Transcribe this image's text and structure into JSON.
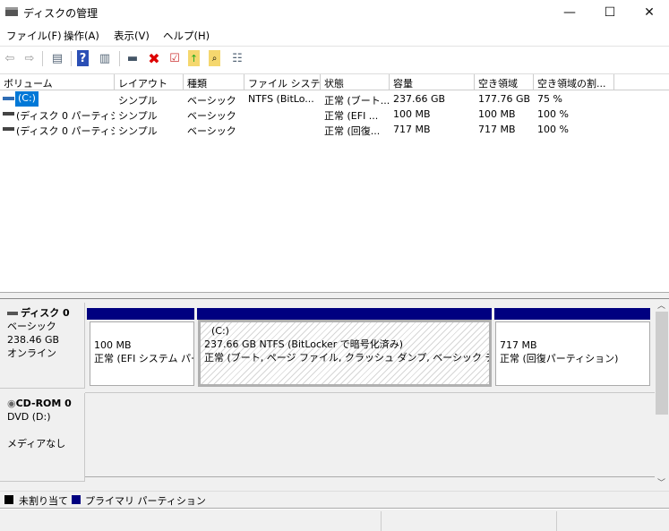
{
  "window": {
    "title": "ディスクの管理",
    "controls": [
      "minimize",
      "maximize",
      "close"
    ]
  },
  "menu": [
    {
      "label": "ファイル(F)"
    },
    {
      "label": "操作(A)"
    },
    {
      "label": "表示(V)"
    },
    {
      "label": "ヘルプ(H)"
    }
  ],
  "toolbar": [
    "back-icon",
    "forward-icon",
    "show-hide-console-tree-icon",
    "help-icon",
    "show-hide-action-pane-icon",
    "connect-disk-icon",
    "delete-icon",
    "properties-icon",
    "import-icon",
    "search-icon",
    "list-view-icon"
  ],
  "table": {
    "columns": [
      "ボリューム",
      "レイアウト",
      "種類",
      "ファイル システム",
      "状態",
      "容量",
      "空き領域",
      "空き領域の割..."
    ],
    "rows": [
      {
        "volume": "(C:)",
        "layout": "シンプル",
        "type": "ベーシック",
        "fs": "NTFS (BitLo...",
        "status": "正常 (ブート...",
        "capacity": "237.66 GB",
        "free": "177.76 GB",
        "pct": "75 %",
        "selected": true
      },
      {
        "volume": "(ディスク 0 パーティシ...",
        "layout": "シンプル",
        "type": "ベーシック",
        "fs": "",
        "status": "正常 (EFI ...",
        "capacity": "100 MB",
        "free": "100 MB",
        "pct": "100 %"
      },
      {
        "volume": "(ディスク 0 パーティシ...",
        "layout": "シンプル",
        "type": "ベーシック",
        "fs": "",
        "status": "正常 (回復...",
        "capacity": "717 MB",
        "free": "717 MB",
        "pct": "100 %"
      }
    ]
  },
  "disks": [
    {
      "name": "ディスク 0",
      "type": "ベーシック",
      "size": "238.46 GB",
      "state": "オンライン",
      "partitions": [
        {
          "title": "",
          "line1": "100 MB",
          "line2": "正常 (EFI システム パー"
        },
        {
          "title": "(C:)",
          "line1": "237.66 GB NTFS (BitLocker で暗号化済み)",
          "line2": "正常 (ブート, ページ ファイル, クラッシュ ダンプ, ベーシック データ パーテ"
        },
        {
          "title": "",
          "line1": "717 MB",
          "line2": "正常 (回復パーティション)"
        }
      ]
    },
    {
      "name": "CD-ROM 0",
      "type": "DVD (D:)",
      "state": "メディアなし"
    }
  ],
  "legend": [
    {
      "label": "未割り当て",
      "color": "#000000"
    },
    {
      "label": "プライマリ パーティション",
      "color": "#000080"
    }
  ],
  "colors": {
    "primary_partition": "#000080",
    "selection": "#0078d7"
  }
}
